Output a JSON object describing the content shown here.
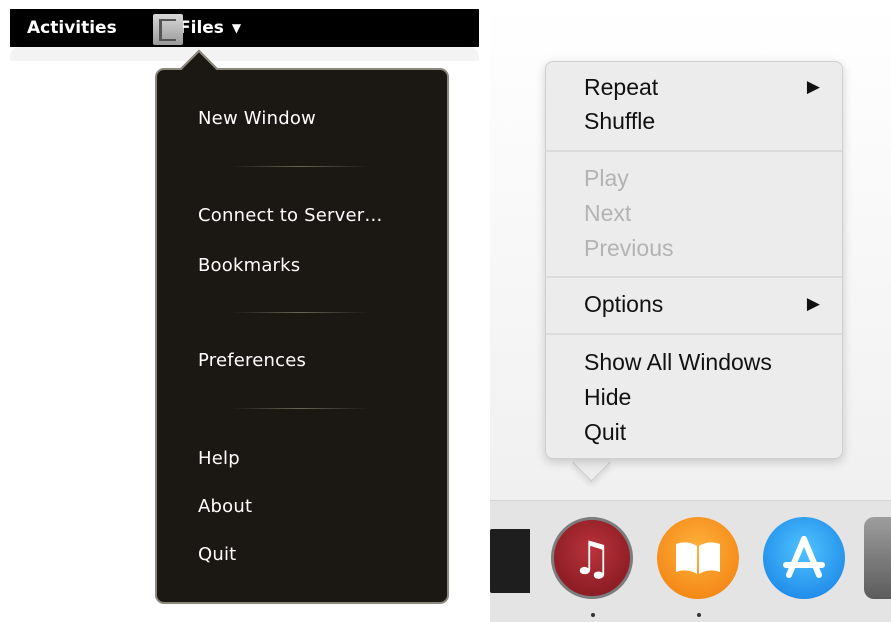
{
  "gnome": {
    "topbar": {
      "activities_label": "Activities",
      "app_label": "Files",
      "caret_icon": "chevron-down-icon"
    },
    "app_menu": {
      "items": [
        {
          "label": "New Window"
        },
        {
          "label": "Connect to Server…"
        },
        {
          "label": "Bookmarks"
        },
        {
          "label": "Preferences"
        },
        {
          "label": "Help"
        },
        {
          "label": "About"
        },
        {
          "label": "Quit"
        }
      ]
    },
    "colors": {
      "menu_bg": "#1b1712",
      "menu_border": "#8d887e",
      "topbar_bg": "#000000"
    }
  },
  "mac": {
    "dock_menu": {
      "items": [
        {
          "label": "Repeat",
          "submenu": true,
          "enabled": true
        },
        {
          "label": "Shuffle",
          "enabled": true
        },
        {
          "label": "Play",
          "enabled": false
        },
        {
          "label": "Next",
          "enabled": false
        },
        {
          "label": "Previous",
          "enabled": false
        },
        {
          "label": "Options",
          "submenu": true,
          "enabled": true
        },
        {
          "label": "Show All Windows",
          "enabled": true
        },
        {
          "label": "Hide",
          "enabled": true
        },
        {
          "label": "Quit",
          "enabled": true
        }
      ],
      "submenu_arrow": "▶"
    },
    "dock": {
      "icons": [
        "music-app-icon",
        "books-app-icon",
        "app-store-icon",
        "system-preferences-icon"
      ],
      "music_glyph": "♫"
    },
    "colors": {
      "menu_bg": "#ececec",
      "disabled_text": "#b3b3b3"
    }
  }
}
